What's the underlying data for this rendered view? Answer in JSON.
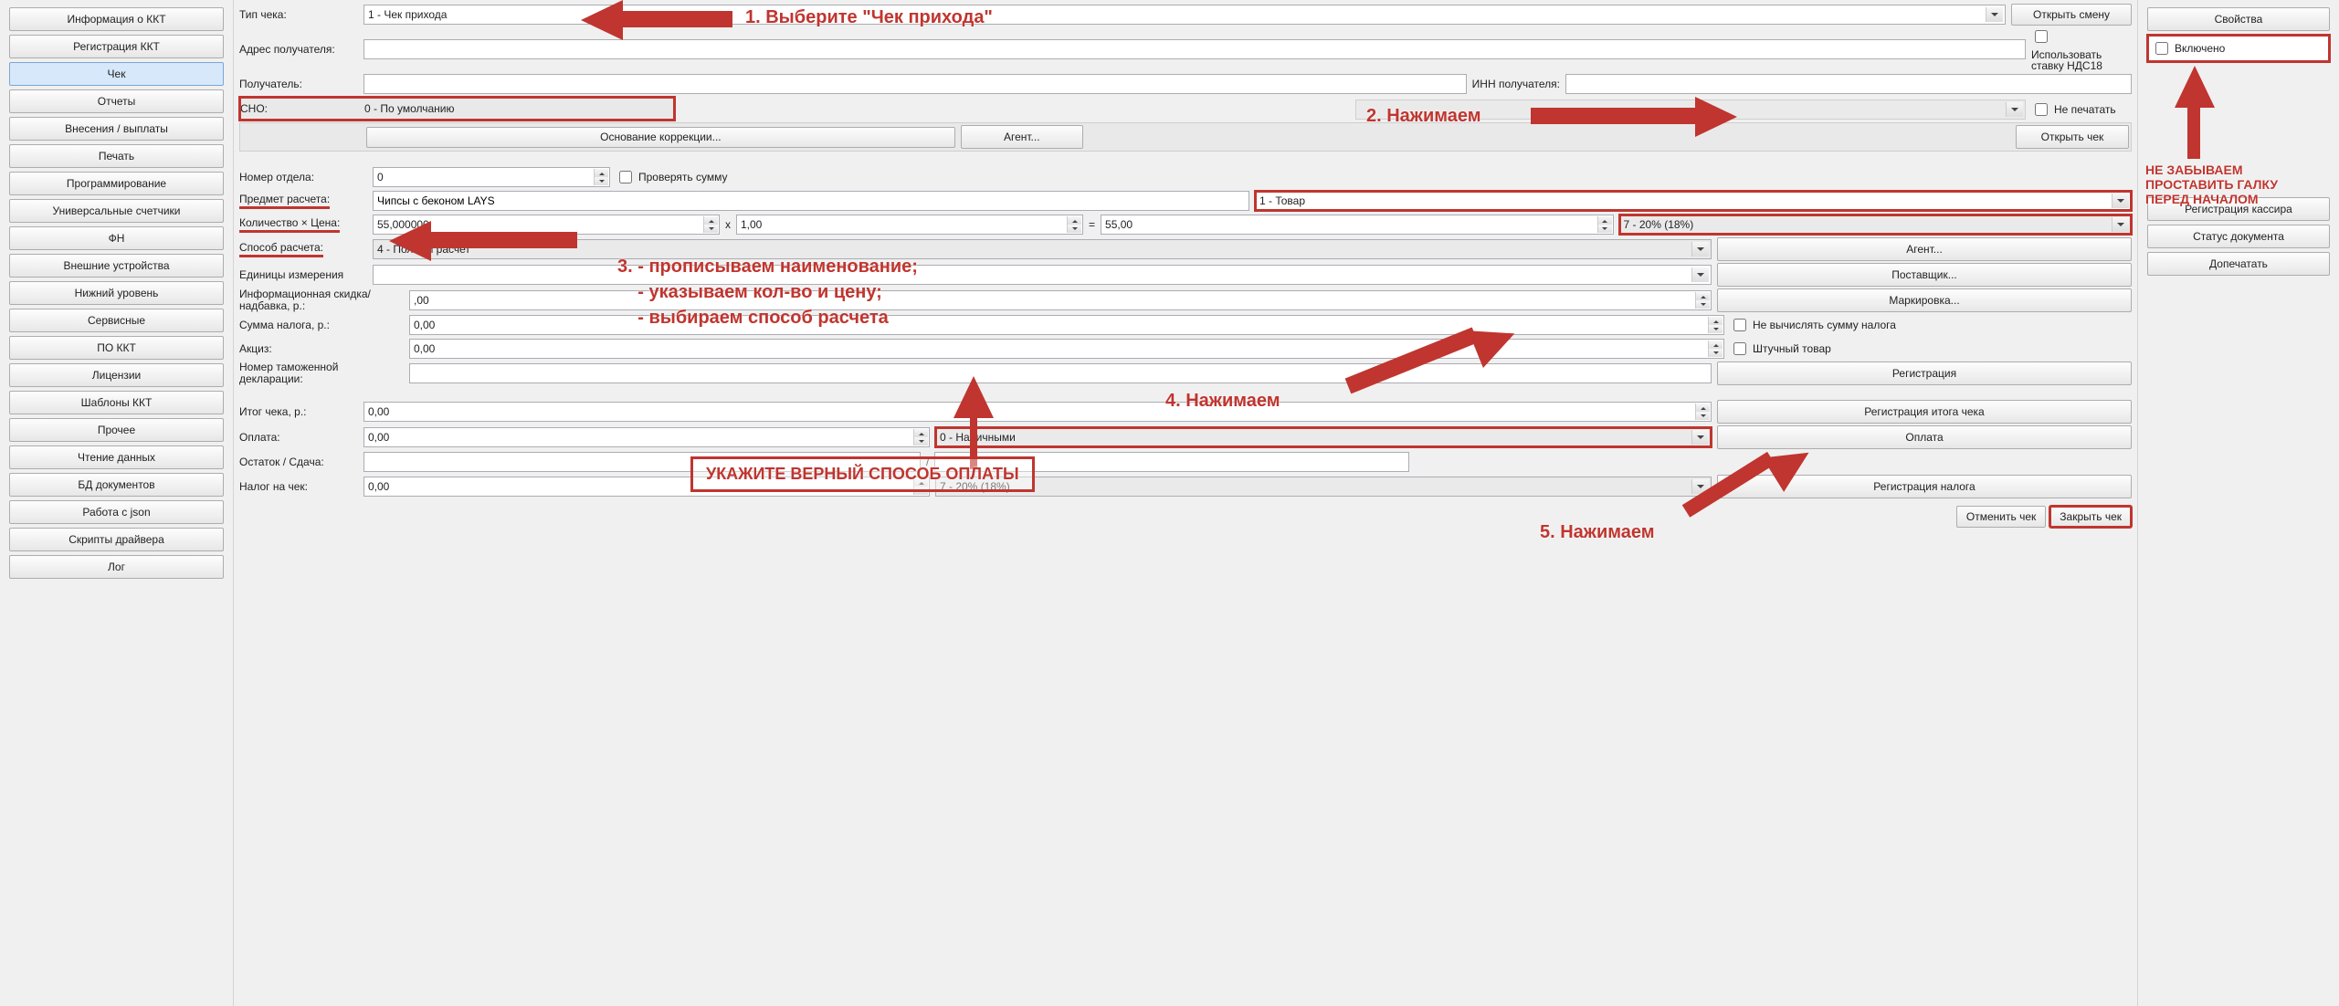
{
  "left_nav": [
    "Информация о ККТ",
    "Регистрация ККТ",
    "Чек",
    "Отчеты",
    "Внесения / выплаты",
    "Печать",
    "Программирование",
    "Универсальные счетчики",
    "ФН",
    "Внешние устройства",
    "Нижний уровень",
    "Сервисные",
    "ПО ККТ",
    "Лицензии",
    "Шаблоны ККТ",
    "Прочее",
    "Чтение данных",
    "БД документов",
    "Работа с json",
    "Скрипты драйвера",
    "Лог"
  ],
  "left_active_index": 2,
  "header": {
    "tip_cheka_label": "Тип чека:",
    "tip_cheka_value": "1 - Чек прихода",
    "open_shift": "Открыть смену",
    "adres_label": "Адрес получателя:",
    "poluchatel_label": "Получатель:",
    "inn_label": "ИНН получателя:",
    "nds18_label": "Использовать ставку НДС18",
    "sno_label": "СНО:",
    "sno_value": "0 - По умолчанию",
    "ne_pechatat": "Не печатать",
    "osnovanie_btn": "Основание коррекции...",
    "agent_btn": "Агент...",
    "open_check": "Открыть чек"
  },
  "item": {
    "nomer_otdela_label": "Номер отдела:",
    "nomer_otdela_value": "0",
    "proveryat_summu": "Проверять сумму",
    "predmet_label": "Предмет расчета:",
    "predmet_value": "Чипсы с беконом LAYS",
    "predmet_type": "1 - Товар",
    "qty_price_label": "Количество × Цена:",
    "qty_value": "55,000000",
    "x_symbol": "x",
    "price_value": "1,00",
    "eq_symbol": "=",
    "total_value": "55,00",
    "vat_value": "7 - 20% (18%)",
    "sposob_label": "Способ расчета:",
    "sposob_value": "4 - Полный расчет",
    "agent_btn2": "Агент...",
    "edinitsy_label": "Единицы измерения",
    "postavshchik_btn": "Поставщик...",
    "info_skidka_label": "Информационная скидка/надбавка, р.:",
    "info_skidka_value": ",00",
    "markirovka_btn": "Маркировка...",
    "summa_naloga_label": "Сумма налога, р.:",
    "summa_naloga_value": "0,00",
    "ne_vychislyat": "Не вычислять сумму налога",
    "akciz_label": "Акциз:",
    "akciz_value": "0,00",
    "shtuchnyy": "Штучный товар",
    "nomer_tamozh_label": "Номер таможенной декларации:",
    "registratsiya_btn": "Регистрация"
  },
  "totals": {
    "itog_label": "Итог чека, р.:",
    "itog_value": "0,00",
    "reg_itog_btn": "Регистрация итога чека",
    "oplata_label": "Оплата:",
    "oplata_value": "0,00",
    "oplata_type": "0 - Наличными",
    "oplata_btn": "Оплата",
    "ostatok_label": "Остаток / Сдача:",
    "slash": "/",
    "nalog_label": "Налог на чек:",
    "nalog_value": "0,00",
    "nalog_type": "7 - 20% (18%)",
    "reg_nalog_btn": "Регистрация налога",
    "cancel_check": "Отменить чек",
    "close_check": "Закрыть чек"
  },
  "right": {
    "props": "Свойства",
    "vklyucheno": "Включено",
    "reg_kassira": "Регистрация кассира",
    "status_doc": "Статус документа",
    "dopechatat": "Допечатать"
  },
  "annotations": {
    "a1": "1. Выберите \"Чек прихода\"",
    "a2": "2. Нажимаем",
    "a3_1": "3. - прописываем наименование;",
    "a3_2": "    - указываем кол-во и цену;",
    "a3_3": "    - выбираем способ расчета",
    "a4": "4. Нажимаем",
    "a5": "5. Нажимаем",
    "box": "УКАЖИТЕ ВЕРНЫЙ СПОСОБ ОПЛАТЫ",
    "remind": "НЕ ЗАБЫВАЕМ ПРОСТАВИТЬ ГАЛКУ ПЕРЕД НАЧАЛОМ"
  }
}
